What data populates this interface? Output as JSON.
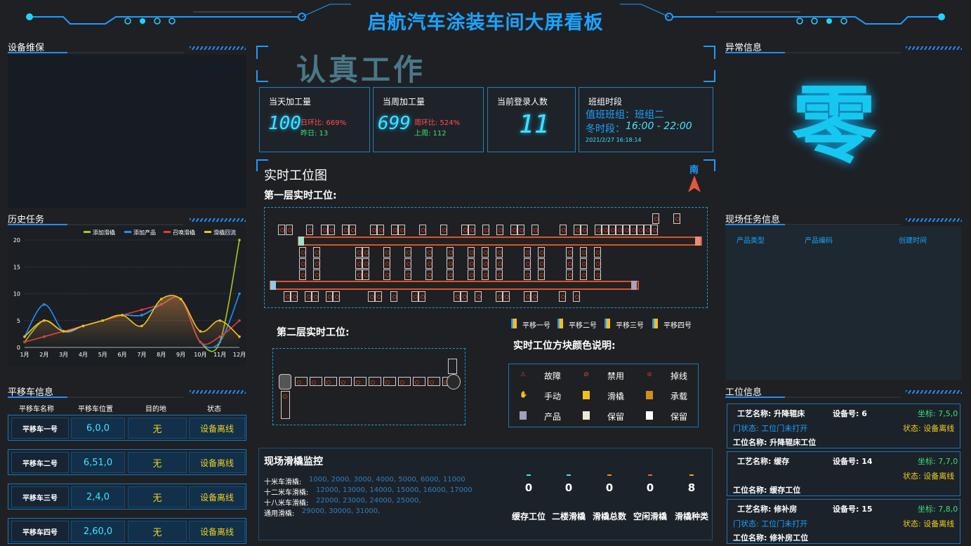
{
  "header": {
    "title": "启航汽车涂装车间大屏看板"
  },
  "left": {
    "maintenance": {
      "title": "设备维保"
    },
    "history": {
      "title": "历史任务"
    },
    "trolley": {
      "title": "平移车信息",
      "columns": [
        "平移车名称",
        "平移车位置",
        "目的地",
        "状态"
      ],
      "rows": [
        {
          "name": "平移车一号",
          "pos": "6,0,0",
          "dest": "无",
          "status": "设备离线"
        },
        {
          "name": "平移车二号",
          "pos": "6,51,0",
          "dest": "无",
          "status": "设备离线"
        },
        {
          "name": "平移车三号",
          "pos": "2,4,0",
          "dest": "无",
          "status": "设备离线"
        },
        {
          "name": "平移车四号",
          "pos": "2,60,0",
          "dest": "无",
          "status": "设备离线"
        }
      ]
    }
  },
  "center": {
    "slogan": "认真工作",
    "kpis": [
      {
        "label": "当天加工量",
        "value": "100",
        "ratio": "日环比: 669%",
        "prev": "昨日: 13"
      },
      {
        "label": "当周加工量",
        "value": "699",
        "ratio": "周环比: 524%",
        "prev": "上周: 112"
      },
      {
        "label": "当前登录人数",
        "value": "11"
      }
    ],
    "shift": {
      "label": "班组时段",
      "team": "值班班组：班组二",
      "period_label": "冬时段：",
      "period": "16:00 - 22:00",
      "datetime": "2021/2/27 16:18:14"
    },
    "map": {
      "title": "实时工位图",
      "compass": "南",
      "floor1": "第一层实时工位:",
      "floor2": "第二层实时工位:",
      "trolley_legend": [
        "平移一号",
        "平移二号",
        "平移三号",
        "平移四号"
      ],
      "color_title": "实时工位方块颜色说明:",
      "color_legend": [
        "故障",
        "禁用",
        "掉线",
        "手动",
        "滑橇",
        "承载",
        "产品",
        "保留",
        "保留"
      ]
    },
    "skid": {
      "title": "现场滑橇监控",
      "lines": [
        {
          "k": "十米车滑橇:",
          "v": "1000, 2000, 3000, 4000, 5000, 6000, 11000"
        },
        {
          "k": "十二米车滑橇:",
          "v": "12000, 13000, 14000, 15000, 16000, 17000"
        },
        {
          "k": "十八米车滑橇:",
          "v": "22000, 23000, 24000, 25000,"
        },
        {
          "k": "通用滑橇:",
          "v": "29000, 30000, 31000,"
        }
      ],
      "stats": [
        {
          "value": "0",
          "label": "缓存工位"
        },
        {
          "value": "0",
          "label": "二楼滑橇"
        },
        {
          "value": "0",
          "label": "滑橇总数"
        },
        {
          "value": "0",
          "label": "空闲滑橇"
        },
        {
          "value": "8",
          "label": "滑橇种类"
        }
      ]
    }
  },
  "right": {
    "abnormal": {
      "title": "异常信息",
      "value": "零"
    },
    "tasks": {
      "title": "现场任务信息",
      "columns": [
        "产品类型",
        "产品编码",
        "创建时间"
      ]
    },
    "stations": {
      "title": "工位信息",
      "cards": [
        {
          "proc": "工艺名称:  升降辊床",
          "dev": "设备号:  6",
          "coord": "坐标:  7,5,0",
          "door": "门状态:  工位门未打开",
          "state": "状态:  设备离线",
          "name": "工位名称:  升降辊床工位"
        },
        {
          "proc": "工艺名称:  缓存",
          "dev": "设备号:  14",
          "coord": "坐标:  7,7,0",
          "door": "",
          "state": "状态:  设备离线",
          "name": "工位名称:  缓存工位"
        },
        {
          "proc": "工艺名称:  修补房",
          "dev": "设备号:  15",
          "coord": "坐标:  7,8,0",
          "door": "门状态:  工位门未打开",
          "state": "状态:  设备离线",
          "name": "工位名称:  修补房工位"
        }
      ]
    }
  },
  "chart_data": {
    "type": "line",
    "categories": [
      "1月",
      "2月",
      "3月",
      "4月",
      "5月",
      "6月",
      "7月",
      "8月",
      "9月",
      "10月",
      "11月",
      "12月"
    ],
    "ylim": [
      0,
      20
    ],
    "yticks": [
      0,
      5,
      10,
      15,
      20
    ],
    "legend_position": "top-right",
    "grid": true,
    "series": [
      {
        "name": "添加滑橇",
        "color": "#a6c81f",
        "values": [
          1,
          5,
          3,
          4,
          5,
          6,
          6,
          8,
          9,
          1,
          1,
          20
        ]
      },
      {
        "name": "添加产品",
        "color": "#1e90ff",
        "values": [
          2,
          8,
          3,
          4,
          5,
          6,
          6,
          8,
          9,
          1,
          1,
          10
        ]
      },
      {
        "name": "召唤滑橇",
        "color": "#e03c3c",
        "values": [
          1,
          2,
          3,
          4,
          5,
          6,
          7,
          8,
          9,
          1,
          2,
          5
        ]
      },
      {
        "name": "滑橇回流",
        "color": "#f0c020",
        "values": [
          2,
          5,
          3,
          4,
          5,
          6,
          4,
          9,
          9,
          3,
          5,
          2
        ]
      }
    ]
  }
}
